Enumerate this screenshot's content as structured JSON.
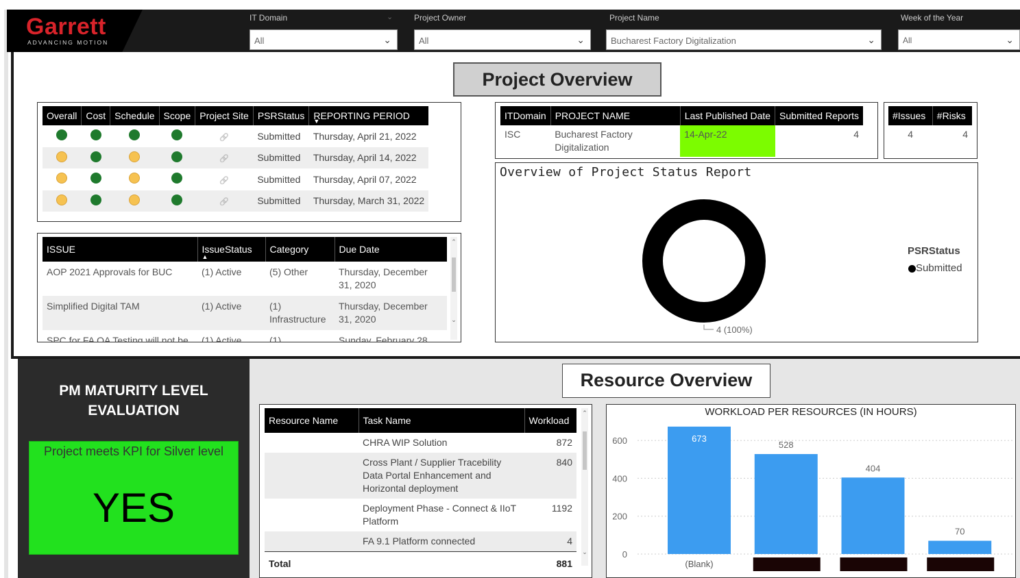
{
  "brand": {
    "name": "Garrett",
    "tagline": "ADVANCING MOTION"
  },
  "slicers": [
    {
      "label": "IT Domain",
      "value": "All"
    },
    {
      "label": "Project Owner",
      "value": "All"
    },
    {
      "label": "Project Name",
      "value": "Bucharest Factory Digitalization"
    },
    {
      "label": "Week of the Year",
      "value": "All"
    }
  ],
  "project_overview_title": "Project Overview",
  "psr_table": {
    "headers": [
      "Overall",
      "Cost",
      "Schedule",
      "Scope",
      "Project Site",
      "PSRStatus",
      "REPORTING PERIOD"
    ],
    "rows": [
      {
        "overall": "green",
        "cost": "green",
        "schedule": "green",
        "scope": "green",
        "status": "Submitted",
        "period": "Thursday, April 21, 2022"
      },
      {
        "overall": "yellow",
        "cost": "green",
        "schedule": "yellow",
        "scope": "green",
        "status": "Submitted",
        "period": "Thursday, April 14, 2022"
      },
      {
        "overall": "yellow",
        "cost": "green",
        "schedule": "yellow",
        "scope": "green",
        "status": "Submitted",
        "period": "Thursday, April 07, 2022"
      },
      {
        "overall": "yellow",
        "cost": "green",
        "schedule": "yellow",
        "scope": "green",
        "status": "Submitted",
        "period": "Thursday, March 31, 2022"
      }
    ]
  },
  "issues_table": {
    "headers": [
      "ISSUE",
      "IssueStatus",
      "Category",
      "Due Date"
    ],
    "rows": [
      {
        "issue": "AOP 2021 Approvals for BUC",
        "status": "(1) Active",
        "category": "(5) Other",
        "due": "Thursday, December 31, 2020"
      },
      {
        "issue": "Simplified Digital TAM",
        "status": "(1) Active",
        "category": "(1) Infrastructure",
        "due": "Thursday, December 31, 2020"
      },
      {
        "issue": "SPC for FA QA Testing will not be",
        "status": "(1) Active",
        "category": "(1)",
        "due": "Sunday, February 28,"
      }
    ]
  },
  "project_table": {
    "headers": [
      "ITDomain",
      "PROJECT NAME",
      "Last Published Date",
      "Submitted Reports"
    ],
    "row": {
      "domain": "ISC",
      "name": "Bucharest Factory Digitalization",
      "published": "14-Apr-22",
      "reports": "4"
    },
    "highlight_color": "#7cfc00"
  },
  "counts_table": {
    "headers": [
      "#Issues",
      "#Risks"
    ],
    "issues": "4",
    "risks": "4"
  },
  "status_chart": {
    "title": "Overview of Project Status Report",
    "legend_title": "PSRStatus",
    "chart_data": {
      "type": "pie",
      "categories": [
        "Submitted"
      ],
      "values": [
        4
      ],
      "title": "Overview of Project Status Report",
      "data_label": "4 (100%)",
      "legend_title": "PSRStatus",
      "legend": [
        "Submitted"
      ]
    }
  },
  "pm_maturity": {
    "title_line1": "PM MATURITY LEVEL",
    "title_line2": "EVALUATION",
    "kpi_text": "Project meets KPI for Silver level",
    "result": "YES"
  },
  "resource_overview_title": "Resource Overview",
  "resource_table": {
    "headers": [
      "Resource Name",
      "Task Name",
      "Workload"
    ],
    "rows": [
      {
        "resource": "",
        "task": "CHRA WIP Solution",
        "workload": "872"
      },
      {
        "resource": "",
        "task": "Cross Plant / Supplier Tracebility Data Portal Enhancement and Horizontal deployment",
        "workload": "840"
      },
      {
        "resource": "",
        "task": "Deployment Phase - Connect & IIoT Platform",
        "workload": "1192"
      },
      {
        "resource": "",
        "task": "FA 9.1 Platform connected",
        "workload": "4"
      }
    ],
    "total_label": "Total",
    "total_value": "881"
  },
  "workload_chart": {
    "title": "WORKLOAD PER RESOURCES (IN HOURS)",
    "bar_color": "#3c9cf0",
    "chart_data": {
      "type": "bar",
      "title": "WORKLOAD PER RESOURCES (IN HOURS)",
      "categories": [
        "(Blank)",
        "",
        "",
        ""
      ],
      "values": [
        673,
        528,
        404,
        70
      ],
      "yticks": [
        0,
        200,
        400,
        600
      ],
      "ylim": [
        0,
        680
      ],
      "grid": true
    }
  }
}
